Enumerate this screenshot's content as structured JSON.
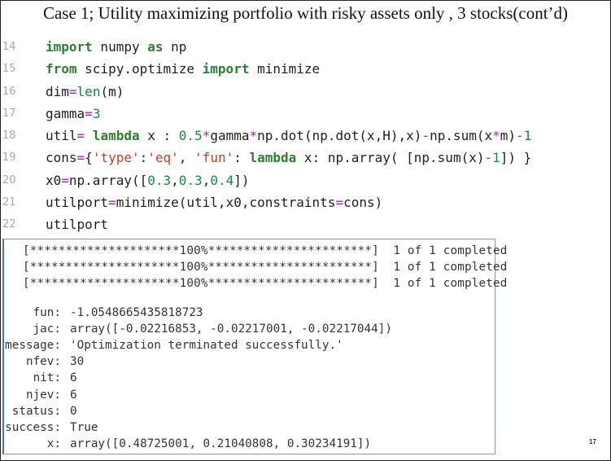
{
  "title": "Case 1; Utility maximizing portfolio with risky assets only , 3 stocks(cont’d)",
  "code_lines": [
    {
      "num": "14",
      "tokens": [
        {
          "t": "import",
          "c": "kw"
        },
        {
          "t": " numpy ",
          "c": ""
        },
        {
          "t": "as",
          "c": "kw"
        },
        {
          "t": " np",
          "c": ""
        }
      ]
    },
    {
      "num": "15",
      "tokens": [
        {
          "t": "from",
          "c": "kw"
        },
        {
          "t": " scipy.optimize ",
          "c": ""
        },
        {
          "t": "import",
          "c": "kw"
        },
        {
          "t": " minimize",
          "c": ""
        }
      ]
    },
    {
      "num": "16",
      "tokens": [
        {
          "t": "dim",
          "c": ""
        },
        {
          "t": "=",
          "c": "op"
        },
        {
          "t": "len",
          "c": "bi"
        },
        {
          "t": "(m)",
          "c": ""
        }
      ]
    },
    {
      "num": "17",
      "tokens": [
        {
          "t": "gamma",
          "c": ""
        },
        {
          "t": "=",
          "c": "op"
        },
        {
          "t": "3",
          "c": "num"
        }
      ]
    },
    {
      "num": "18",
      "tokens": [
        {
          "t": "util",
          "c": ""
        },
        {
          "t": "=",
          "c": "op"
        },
        {
          "t": " ",
          "c": ""
        },
        {
          "t": "lambda",
          "c": "kw"
        },
        {
          "t": " x : ",
          "c": ""
        },
        {
          "t": "0.5",
          "c": "num"
        },
        {
          "t": "*",
          "c": "op"
        },
        {
          "t": "gamma",
          "c": ""
        },
        {
          "t": "*",
          "c": "op"
        },
        {
          "t": "np.dot(np.dot(x,H),x)",
          "c": ""
        },
        {
          "t": "-",
          "c": "op"
        },
        {
          "t": "np.sum(x",
          "c": ""
        },
        {
          "t": "*",
          "c": "op"
        },
        {
          "t": "m)",
          "c": ""
        },
        {
          "t": "-",
          "c": "op"
        },
        {
          "t": "1",
          "c": "num"
        }
      ]
    },
    {
      "num": "19",
      "tokens": [
        {
          "t": "cons",
          "c": ""
        },
        {
          "t": "=",
          "c": "op"
        },
        {
          "t": "{",
          "c": ""
        },
        {
          "t": "'type'",
          "c": "str"
        },
        {
          "t": ":",
          "c": ""
        },
        {
          "t": "'eq'",
          "c": "str"
        },
        {
          "t": ", ",
          "c": ""
        },
        {
          "t": "'fun'",
          "c": "str"
        },
        {
          "t": ": ",
          "c": ""
        },
        {
          "t": "lambda",
          "c": "kw"
        },
        {
          "t": " x: np.array( [np.sum(x)",
          "c": ""
        },
        {
          "t": "-",
          "c": "op"
        },
        {
          "t": "1",
          "c": "num"
        },
        {
          "t": "]) }",
          "c": ""
        }
      ]
    },
    {
      "num": "20",
      "tokens": [
        {
          "t": "x0",
          "c": ""
        },
        {
          "t": "=",
          "c": "op"
        },
        {
          "t": "np.array([",
          "c": ""
        },
        {
          "t": "0.3",
          "c": "num"
        },
        {
          "t": ",",
          "c": ""
        },
        {
          "t": "0.3",
          "c": "num"
        },
        {
          "t": ",",
          "c": ""
        },
        {
          "t": "0.4",
          "c": "num"
        },
        {
          "t": "])",
          "c": ""
        }
      ]
    },
    {
      "num": "21",
      "tokens": [
        {
          "t": "utilport",
          "c": ""
        },
        {
          "t": "=",
          "c": "op"
        },
        {
          "t": "minimize(util,x0,constraints",
          "c": ""
        },
        {
          "t": "=",
          "c": "op"
        },
        {
          "t": "cons)",
          "c": ""
        }
      ]
    },
    {
      "num": "22",
      "tokens": [
        {
          "t": "utilport",
          "c": ""
        }
      ]
    }
  ],
  "progress_lines": [
    "[*********************100%***********************]  1 of 1 completed",
    "[*********************100%***********************]  1 of 1 completed",
    "[*********************100%***********************]  1 of 1 completed"
  ],
  "result": [
    {
      "key": "fun:",
      "value": "-1.0548665435818723"
    },
    {
      "key": "jac:",
      "value": "array([-0.02216853, -0.02217001, -0.02217044])"
    },
    {
      "key": "message:",
      "value": "'Optimization terminated successfully.'"
    },
    {
      "key": "nfev:",
      "value": "30"
    },
    {
      "key": "nit:",
      "value": "6"
    },
    {
      "key": "njev:",
      "value": "6"
    },
    {
      "key": "status:",
      "value": "0"
    },
    {
      "key": "success:",
      "value": "True"
    },
    {
      "key": "x:",
      "value": "array([0.48725001, 0.21040808, 0.30234191])"
    }
  ],
  "page_number": "17",
  "colors": {
    "keyword": "#2e7d32",
    "string": "#b5402c",
    "number": "#1a8a3a",
    "operator": "#9c27b0",
    "line_number": "#a8a8a8",
    "output_border": "#4a78b0"
  }
}
